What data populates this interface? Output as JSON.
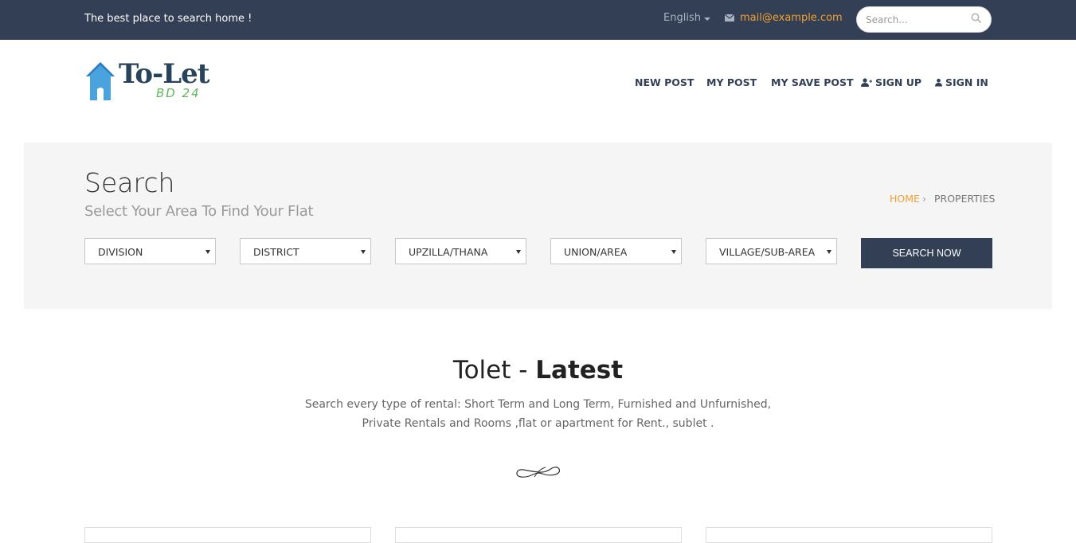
{
  "topbar": {
    "tagline": "The best place to search home !",
    "language": "English",
    "email": "mail@example.com",
    "search_placeholder": "Search...",
    "colors": {
      "background": "#323f55",
      "accent": "#f0a030"
    }
  },
  "header": {
    "logo": {
      "word": "To-Let",
      "sub": "BD 24"
    },
    "nav": [
      {
        "label": "NEW POST"
      },
      {
        "label": "MY POST"
      },
      {
        "label": "MY SAVE POST"
      },
      {
        "label": "SIGN UP",
        "icon": "user-plus-icon"
      },
      {
        "label": "SIGN IN",
        "icon": "user-icon"
      }
    ]
  },
  "search_panel": {
    "title": "Search",
    "subtitle": "Select Your Area To Find Your Flat",
    "breadcrumb": {
      "home": "HOME",
      "separator": "›",
      "current": "PROPERTIES"
    },
    "dropdowns": [
      {
        "selected": "DIVISION"
      },
      {
        "selected": "DISTRICT"
      },
      {
        "selected": "UPZILLA/THANA"
      },
      {
        "selected": "UNION/AREA"
      },
      {
        "selected": "VILLAGE/SUB-AREA"
      }
    ],
    "button": "SEARCH NOW"
  },
  "latest": {
    "title_plain": "Tolet - ",
    "title_bold": "Latest",
    "desc_line1": "Search every type of rental: Short Term and Long Term, Furnished and Unfurnished,",
    "desc_line2": "Private Rentals and Rooms ,flat or apartment for Rent., sublet ."
  }
}
